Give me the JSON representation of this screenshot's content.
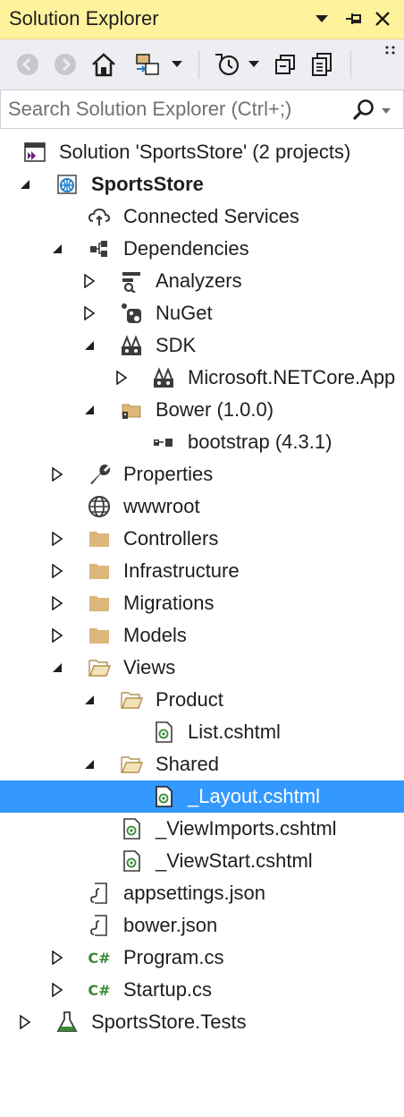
{
  "panel": {
    "title": "Solution Explorer"
  },
  "search": {
    "placeholder": "Search Solution Explorer (Ctrl+;)"
  },
  "tree": {
    "solution": "Solution 'SportsStore' (2 projects)",
    "project": "SportsStore",
    "connected_services": "Connected Services",
    "dependencies": "Dependencies",
    "analyzers": "Analyzers",
    "nuget": "NuGet",
    "sdk": "SDK",
    "netcore_app": "Microsoft.NETCore.App",
    "bower": "Bower (1.0.0)",
    "bootstrap": "bootstrap (4.3.1)",
    "properties": "Properties",
    "wwwroot": "wwwroot",
    "controllers": "Controllers",
    "infrastructure": "Infrastructure",
    "migrations": "Migrations",
    "models": "Models",
    "views": "Views",
    "product": "Product",
    "list_cshtml": "List.cshtml",
    "shared": "Shared",
    "layout_cshtml": "_Layout.cshtml",
    "viewimports": "_ViewImports.cshtml",
    "viewstart": "_ViewStart.cshtml",
    "appsettings": "appsettings.json",
    "bower_json": "bower.json",
    "program_cs": "Program.cs",
    "startup_cs": "Startup.cs",
    "tests_project": "SportsStore.Tests"
  },
  "icon_text": {
    "csharp": "C#"
  },
  "colors": {
    "title_bar": "#fff29d",
    "toolbar": "#eeeef2",
    "selection": "#3399ff",
    "folder": "#dcb67a",
    "solution_purple": "#68217a",
    "project_blue": "#1f7fd1",
    "csharp_green": "#388a34"
  }
}
